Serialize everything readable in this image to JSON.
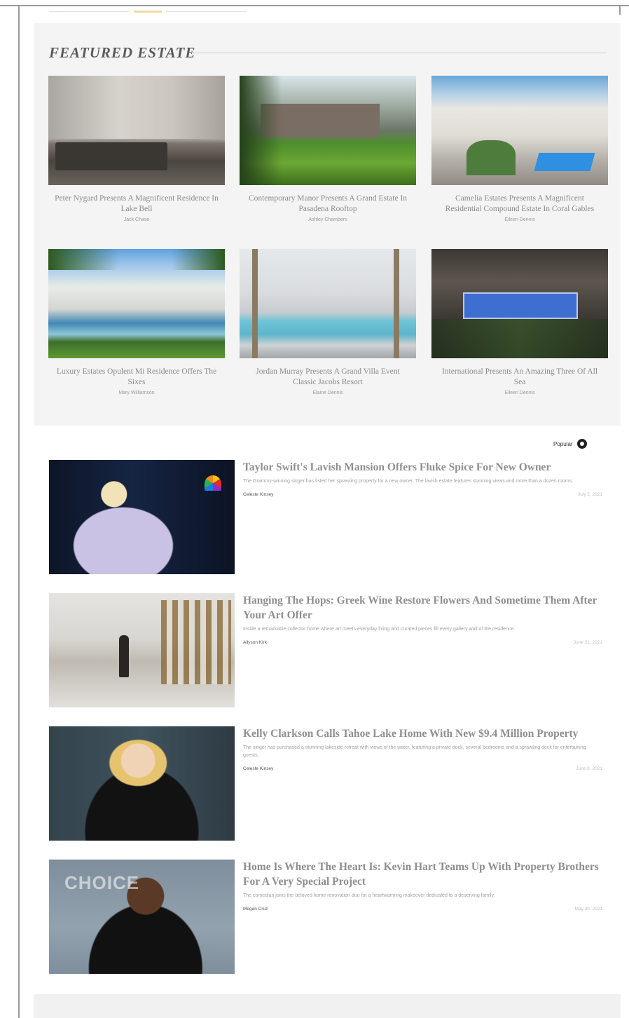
{
  "featured": {
    "title": "FEATURED ESTATE",
    "cards": [
      {
        "caption": "Peter Nygard Presents A Magnificent Residence In Lake Bell",
        "byline": "Jack Chase",
        "image": "interior-living-room"
      },
      {
        "caption": "Contemporary Manor Presents A Grand Estate In Pasadena Rooftop",
        "byline": "Ashley Chambers",
        "image": "garden-manor"
      },
      {
        "caption": "Camelia Estates Presents A Magnificent Residential Compound Estate In Coral Gables",
        "byline": "Eileen Dennis",
        "image": "modern-house-pool"
      },
      {
        "caption": "Luxury Estates Opulent Mi Residence Offers The Sixes",
        "byline": "Mary Williamson",
        "image": "resort-pool-garden"
      },
      {
        "caption": "Jordan Murray Presents A Grand Villa Event Classic Jacobs Resort",
        "byline": "Elaine Dennis",
        "image": "villa-pool"
      },
      {
        "caption": "International Presents An Amazing Three Of All Sea",
        "byline": "Eileen Dennis",
        "image": "building-night"
      }
    ]
  },
  "sort": {
    "label": "Popular",
    "icon": "circle-dot-icon"
  },
  "articles": [
    {
      "headline": "Taylor Swift's Lavish Mansion Offers Fluke Spice For New Owner",
      "excerpt": "The Grammy-winning singer has listed her sprawling property for a new owner. The lavish estate features stunning views and more than a dozen rooms.",
      "author": "Celeste Kinsey",
      "date": "July 2, 2021",
      "image": "taylor-red-carpet"
    },
    {
      "headline": "Hanging The Hops: Greek Wine Restore Flowers And Sometime Them After Your Art Offer",
      "excerpt": "Inside a remarkable collector home where art meets everyday living and curated pieces fill every gallery wall of the residence.",
      "author": "Allyson Kirk",
      "date": "June 21, 2021",
      "image": "art-gallery"
    },
    {
      "headline": "Kelly Clarkson Calls Tahoe Lake Home With New $9.4 Million Property",
      "excerpt": "The singer has purchased a stunning lakeside retreat with views of the water, featuring a private dock, several bedrooms and a sprawling deck for entertaining guests.",
      "author": "Celeste Kinsey",
      "date": "June 8, 2021",
      "image": "kelly-red-carpet"
    },
    {
      "headline": "Home Is Where The Heart Is: Kevin Hart Teams Up With Property Brothers For A Very Special Project",
      "excerpt": "The comedian joins the beloved home renovation duo for a heartwarming makeover dedicated to a deserving family.",
      "author": "Megan Cruz",
      "date": "May 30, 2021",
      "image": "kevin-red-carpet"
    }
  ]
}
